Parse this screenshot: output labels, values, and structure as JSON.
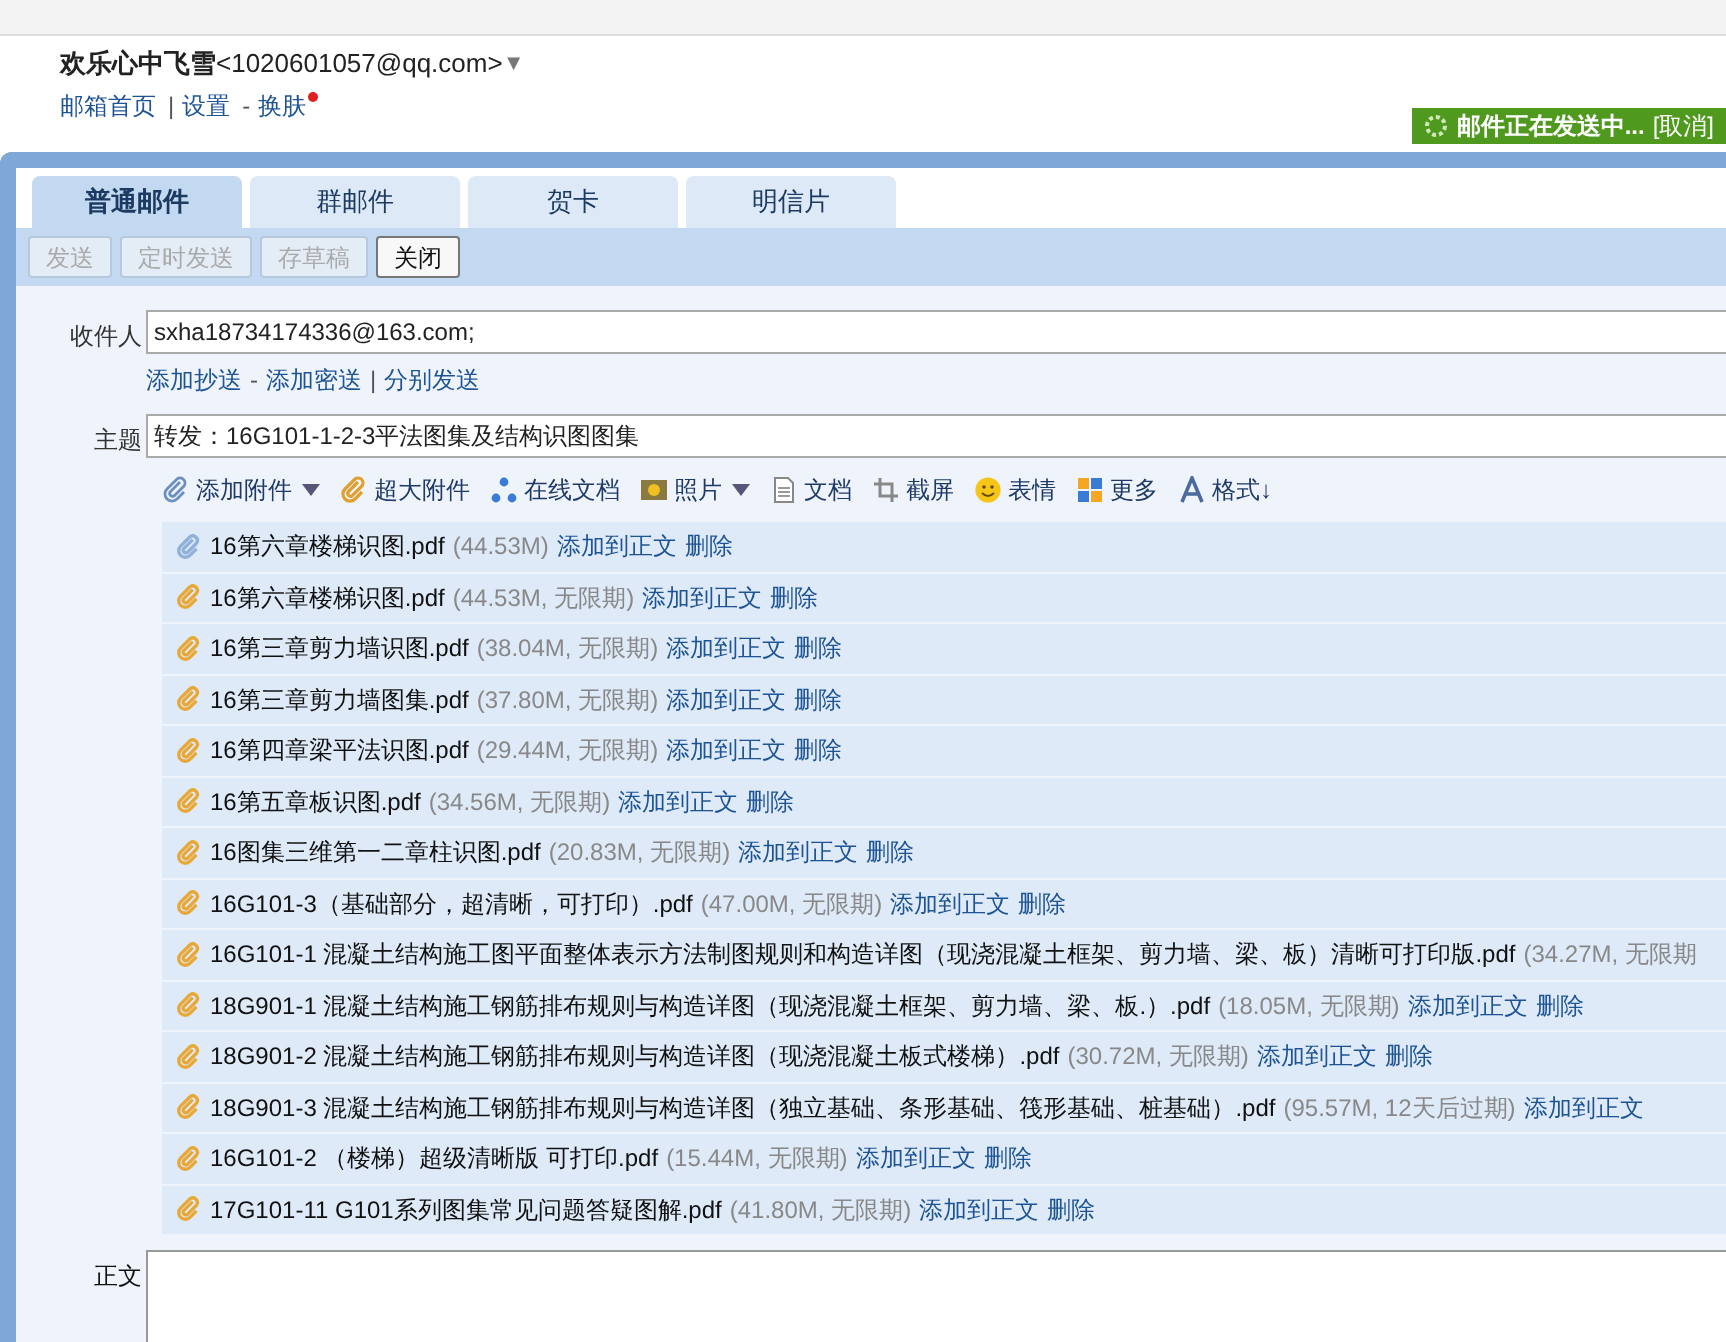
{
  "account": {
    "name": "欢乐心中飞雪",
    "email": "<1020601057@qq.com>",
    "caret": "▼"
  },
  "header_links": [
    {
      "label": "邮箱首页",
      "sep": "|"
    },
    {
      "label": "设置",
      "sep": "-"
    },
    {
      "label": "换肤",
      "dot": true
    }
  ],
  "sending_banner": {
    "text": "邮件正在发送中...",
    "cancel": "[取消]"
  },
  "tabs": [
    {
      "label": "普通邮件",
      "selected": true
    },
    {
      "label": "群邮件",
      "selected": false
    },
    {
      "label": "贺卡",
      "selected": false
    },
    {
      "label": "明信片",
      "selected": false
    }
  ],
  "toolbar_buttons": [
    {
      "label": "发送",
      "disabled": true
    },
    {
      "label": "定时发送",
      "disabled": true
    },
    {
      "label": "存草稿",
      "disabled": true
    },
    {
      "label": "关闭",
      "disabled": false
    }
  ],
  "recipient": {
    "label": "收件人",
    "value": "sxha18734174336@163.com;"
  },
  "recipient_links": [
    {
      "label": "添加抄送",
      "sep": "-"
    },
    {
      "label": "添加密送",
      "sep": "|"
    },
    {
      "label": "分别发送"
    }
  ],
  "subject": {
    "label": "主题",
    "value": "转发：16G101-1-2-3平法图集及结构识图图集"
  },
  "compose_tools": [
    {
      "kind": "attach",
      "label": "添加附件",
      "dropdown": true
    },
    {
      "kind": "bigattach",
      "label": "超大附件",
      "dropdown": false
    },
    {
      "kind": "doc",
      "label": "在线文档",
      "dropdown": false
    },
    {
      "kind": "photo",
      "label": "照片",
      "dropdown": true
    },
    {
      "kind": "file",
      "label": "文档",
      "dropdown": false
    },
    {
      "kind": "screenshot",
      "label": "截屏",
      "dropdown": false
    },
    {
      "kind": "emoji",
      "label": "表情",
      "dropdown": false
    },
    {
      "kind": "more",
      "label": "更多",
      "dropdown": false
    },
    {
      "kind": "format",
      "label": "格式↓",
      "dropdown": false
    }
  ],
  "attachments": [
    {
      "kind": "normal",
      "name": "16第六章楼梯识图.pdf",
      "meta": "(44.53M)",
      "add": "添加到正文",
      "delete": "删除"
    },
    {
      "kind": "large",
      "name": "16第六章楼梯识图.pdf",
      "meta": "(44.53M, 无限期)",
      "add": "添加到正文",
      "delete": "删除"
    },
    {
      "kind": "large",
      "name": "16第三章剪力墙识图.pdf",
      "meta": "(38.04M, 无限期)",
      "add": "添加到正文",
      "delete": "删除"
    },
    {
      "kind": "large",
      "name": "16第三章剪力墙图集.pdf",
      "meta": "(37.80M, 无限期)",
      "add": "添加到正文",
      "delete": "删除"
    },
    {
      "kind": "large",
      "name": "16第四章梁平法识图.pdf",
      "meta": "(29.44M, 无限期)",
      "add": "添加到正文",
      "delete": "删除"
    },
    {
      "kind": "large",
      "name": "16第五章板识图.pdf",
      "meta": "(34.56M, 无限期)",
      "add": "添加到正文",
      "delete": "删除"
    },
    {
      "kind": "large",
      "name": "16图集三维第一二章柱识图.pdf",
      "meta": "(20.83M, 无限期)",
      "add": "添加到正文",
      "delete": "删除"
    },
    {
      "kind": "large",
      "name": "16G101-3（基础部分，超清晰，可打印）.pdf",
      "meta": "(47.00M, 无限期)",
      "add": "添加到正文",
      "delete": "删除"
    },
    {
      "kind": "large",
      "name": "16G101-1 混凝土结构施工图平面整体表示方法制图规则和构造详图（现浇混凝土框架、剪力墙、梁、板）清晰可打印版.pdf",
      "meta": "(34.27M, 无限期"
    },
    {
      "kind": "large",
      "name": "18G901-1 混凝土结构施工钢筋排布规则与构造详图（现浇混凝土框架、剪力墙、梁、板.）.pdf",
      "meta": "(18.05M, 无限期)",
      "add": "添加到正文",
      "delete": "删除"
    },
    {
      "kind": "large",
      "name": "18G901-2 混凝土结构施工钢筋排布规则与构造详图（现浇混凝土板式楼梯）.pdf",
      "meta": "(30.72M, 无限期)",
      "add": "添加到正文",
      "delete": "删除"
    },
    {
      "kind": "large",
      "name": "18G901-3 混凝土结构施工钢筋排布规则与构造详图（独立基础、条形基础、筏形基础、桩基础）.pdf",
      "meta": "(95.57M, 12天后过期)",
      "add": "添加到正文"
    },
    {
      "kind": "large",
      "name": "16G101-2 （楼梯）超级清晰版 可打印.pdf",
      "meta": "(15.44M, 无限期)",
      "add": "添加到正文",
      "delete": "删除"
    },
    {
      "kind": "large",
      "name": "17G101-11 G101系列图集常见问题答疑图解.pdf",
      "meta": "(41.80M, 无限期)",
      "add": "添加到正文",
      "delete": "删除"
    }
  ],
  "body": {
    "label": "正文"
  }
}
